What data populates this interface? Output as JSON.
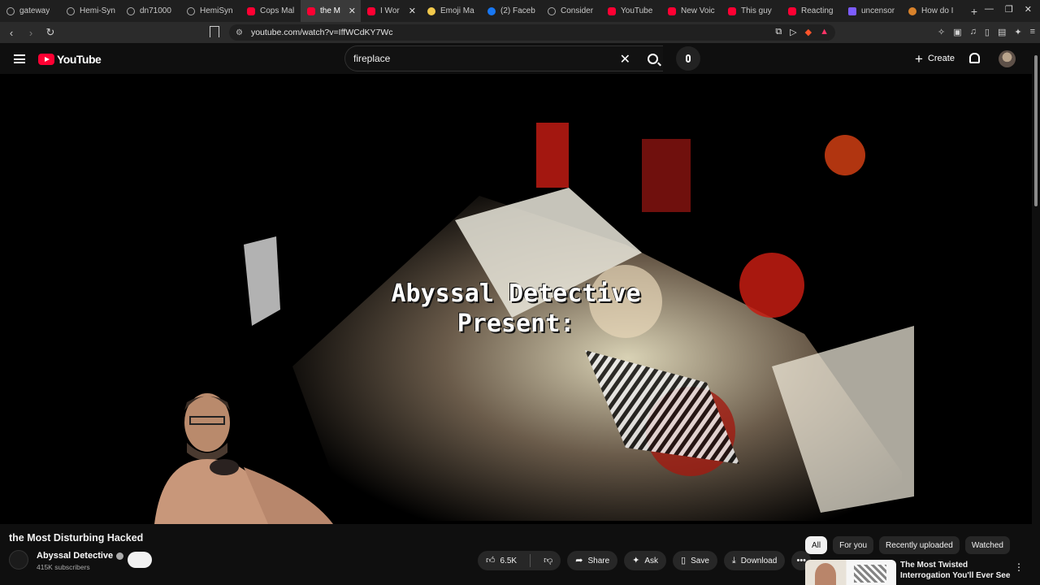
{
  "browser": {
    "tabs": [
      {
        "label": "gateway",
        "icon": "globe-icon",
        "active": false
      },
      {
        "label": "Hemi-Syn",
        "icon": "globe-icon",
        "active": false
      },
      {
        "label": "dn71000",
        "icon": "globe-icon",
        "active": false
      },
      {
        "label": "HemiSyn",
        "icon": "globe-icon",
        "active": false
      },
      {
        "label": "Cops Mal",
        "icon": "youtube-icon",
        "active": false
      },
      {
        "label": "the M",
        "icon": "youtube-icon",
        "active": true
      },
      {
        "label": "I Wor",
        "icon": "youtube-icon",
        "active": false
      },
      {
        "label": "Emoji Ma",
        "icon": "emoji-icon",
        "active": false
      },
      {
        "label": "(2) Faceb",
        "icon": "facebook-icon",
        "active": false
      },
      {
        "label": "Consider",
        "icon": "globe-icon",
        "active": false
      },
      {
        "label": "YouTube",
        "icon": "youtube-icon",
        "active": false
      },
      {
        "label": "New Voic",
        "icon": "youtube-icon",
        "active": false
      },
      {
        "label": "This guy",
        "icon": "youtube-icon",
        "active": false
      },
      {
        "label": "Reacting",
        "icon": "youtube-icon",
        "active": false
      },
      {
        "label": "uncensor",
        "icon": "doc-icon",
        "active": false
      },
      {
        "label": "How do I",
        "icon": "bulb-icon",
        "active": false
      }
    ],
    "new_tab": "+",
    "url": "youtube.com/watch?v=IffWCdKY7Wc"
  },
  "youtube": {
    "logo_text": "YouTube",
    "search_value": "fireplace",
    "create_label": "Create"
  },
  "video": {
    "overlay_line1": "Abyssal Detective",
    "overlay_line2": "Present:",
    "title": "the Most Disturbing Hacked",
    "channel": "Abyssal Detective",
    "subscribers": "415K subscribers",
    "likes": "6.5K",
    "share_label": "Share",
    "ask_label": "Ask",
    "save_label": "Save",
    "download_label": "Download"
  },
  "sidebar": {
    "chips": [
      "All",
      "For you",
      "Recently uploaded",
      "Watched"
    ],
    "active_chip": "All",
    "recommendation_title": "The Most Twisted Interrogation You'll Ever See"
  },
  "colors": {
    "brand": "#ff0033",
    "background": "#0f0f0f",
    "pill": "#272727"
  }
}
